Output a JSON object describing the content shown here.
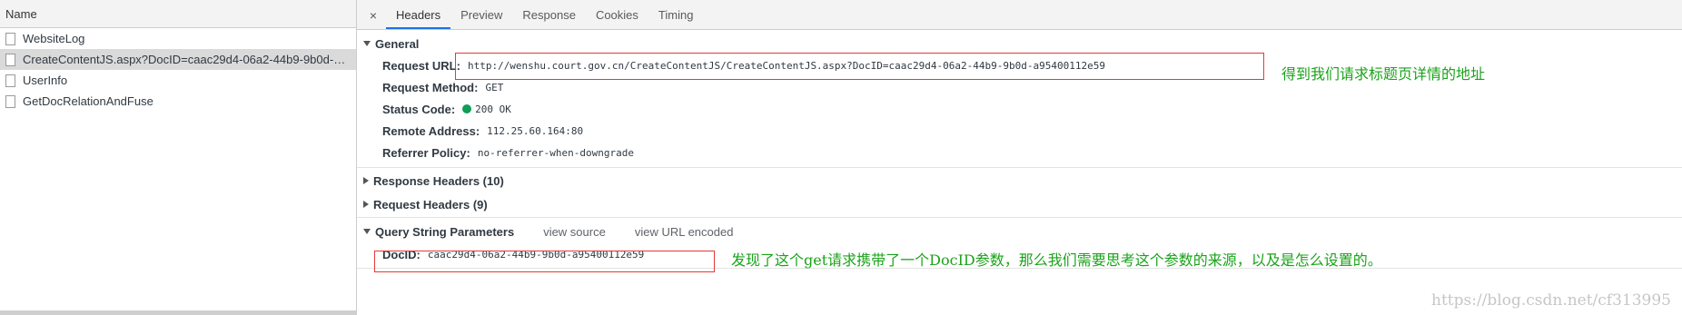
{
  "left": {
    "header": "Name",
    "items": [
      {
        "name": "WebsiteLog"
      },
      {
        "name": "CreateContentJS.aspx?DocID=caac29d4-06a2-44b9-9b0d-a9..."
      },
      {
        "name": "UserInfo"
      },
      {
        "name": "GetDocRelationAndFuse"
      }
    ],
    "selected_index": 1
  },
  "tabs": [
    "Headers",
    "Preview",
    "Response",
    "Cookies",
    "Timing"
  ],
  "active_tab": "Headers",
  "close_glyph": "×",
  "general": {
    "title": "General",
    "rows": [
      {
        "key": "Request URL:",
        "value": "http://wenshu.court.gov.cn/CreateContentJS/CreateContentJS.aspx?DocID=caac29d4-06a2-44b9-9b0d-a95400112e59"
      },
      {
        "key": "Request Method:",
        "value": "GET"
      },
      {
        "key": "Status Code:",
        "value": "200 OK",
        "status_color": "#0f9d58"
      },
      {
        "key": "Remote Address:",
        "value": "112.25.60.164:80"
      },
      {
        "key": "Referrer Policy:",
        "value": "no-referrer-when-downgrade"
      }
    ]
  },
  "response_headers": {
    "title": "Response Headers (10)"
  },
  "request_headers": {
    "title": "Request Headers (9)"
  },
  "query": {
    "title": "Query String Parameters",
    "view_source": "view source",
    "view_url_encoded": "view URL encoded",
    "param_key": "DocID:",
    "param_value": "caac29d4-06a2-44b9-9b0d-a95400112e59"
  },
  "annotations": {
    "url_note": "得到我们请求标题页详情的地址",
    "param_note": "发现了这个get请求携带了一个DocID参数，那么我们需要思考这个参数的来源，以及是怎么设置的。",
    "color": "#1aa31a",
    "box_color": "#e53935"
  },
  "watermark": "https://blog.csdn.net/cf313995"
}
